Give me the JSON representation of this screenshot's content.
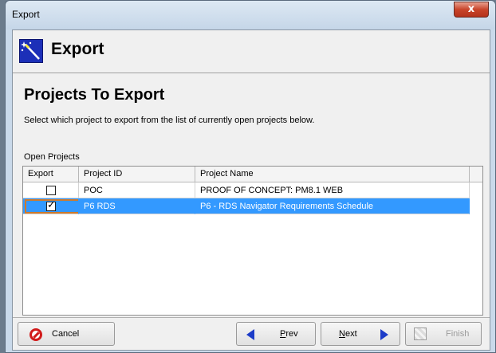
{
  "window": {
    "title": "Export",
    "close_label": "x"
  },
  "header": {
    "title": "Export",
    "icon": "magic-wand-icon"
  },
  "section": {
    "title": "Projects To Export",
    "instruction": "Select which project to export from the list of currently open projects below."
  },
  "list": {
    "label": "Open Projects",
    "columns": [
      "Export",
      "Project ID",
      "Project Name"
    ],
    "rows": [
      {
        "export": false,
        "project_id": "POC",
        "project_name": "PROOF OF CONCEPT: PM8.1 WEB",
        "selected": false
      },
      {
        "export": true,
        "project_id": "P6 RDS",
        "project_name": "P6 - RDS Navigator Requirements Schedule",
        "selected": true
      }
    ]
  },
  "buttons": {
    "cancel": "Cancel",
    "prev_u": "P",
    "prev_rest": "rev",
    "next_u": "N",
    "next_rest": "ext",
    "finish": "Finish"
  },
  "colors": {
    "selection": "#3399ff",
    "focus_border": "#d07a2b",
    "arrow": "#1c3cc8",
    "cancel_icon": "#d11b1b"
  }
}
